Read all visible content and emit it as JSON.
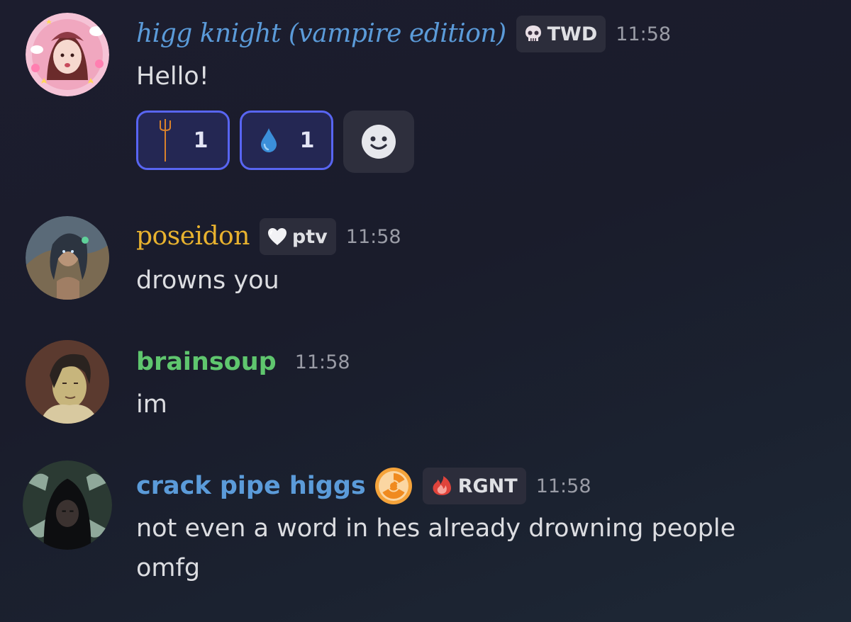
{
  "messages": [
    {
      "username": "higg knight (vampire edition)",
      "username_color": "#5b9bd9",
      "tag_icon": "skull-icon",
      "tag": "TWD",
      "time": "11:58",
      "text": "Hello!",
      "reactions": [
        {
          "emoji": "trident-icon",
          "count": "1"
        },
        {
          "emoji": "droplet-icon",
          "count": "1"
        }
      ],
      "add_reaction_icon": "smiley-icon"
    },
    {
      "username": "poseidon",
      "username_color": "#e8b22f",
      "tag_icon": "heart-icon",
      "tag": "ptv",
      "time": "11:58",
      "text": "drowns you"
    },
    {
      "username": "brainsoup",
      "username_color": "#5fc66e",
      "time": "11:58",
      "text": "im"
    },
    {
      "username": "crack pipe higgs",
      "username_color": "#5b9bd9",
      "status_icon": "radioactive-icon",
      "tag_icon": "fire-icon",
      "tag": "RGNT",
      "time": "11:58",
      "text": "not even a word in hes already drowning people omfg"
    }
  ],
  "colors": {
    "background": "#1c1d2e",
    "reaction_border": "#5865f2",
    "reaction_bg": "#242753",
    "tag_bg": "#2c2d3b"
  }
}
